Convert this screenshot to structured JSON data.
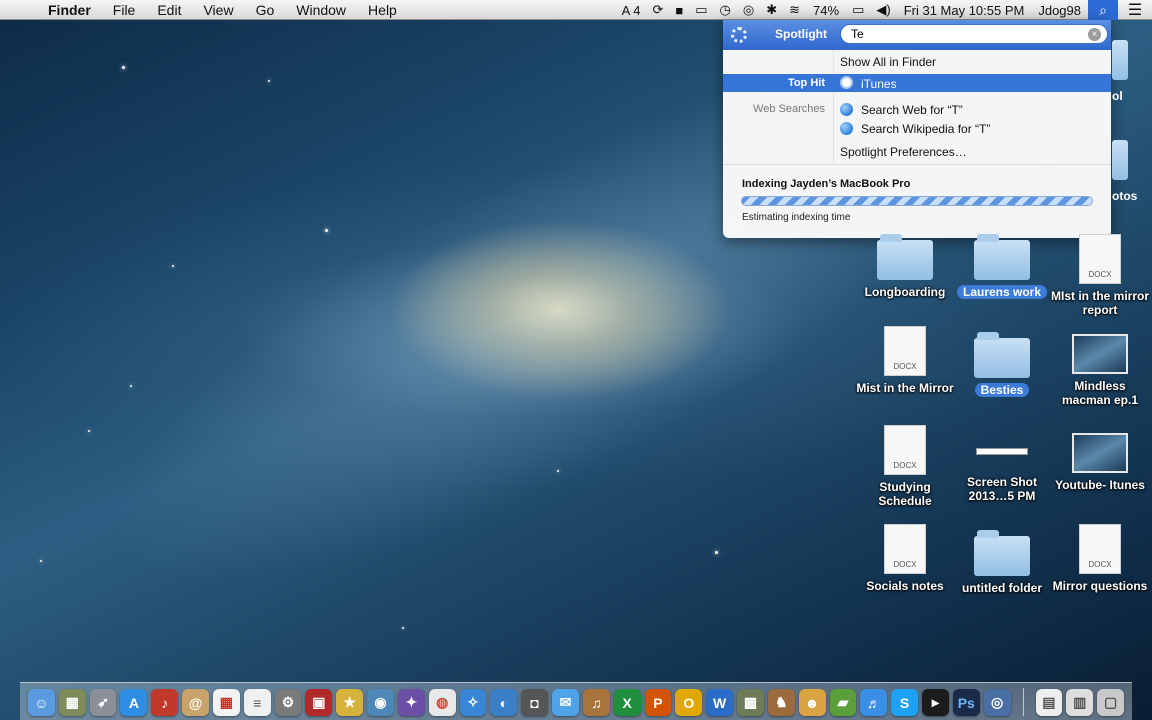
{
  "menubar": {
    "app_name": "Finder",
    "menus": [
      "File",
      "Edit",
      "View",
      "Go",
      "Window",
      "Help"
    ],
    "status": {
      "adobe_count": "4",
      "battery": "74%",
      "datetime": "Fri 31 May  10:55 PM",
      "user": "Jdog98"
    }
  },
  "spotlight": {
    "title": "Spotlight",
    "query": "Te",
    "show_all": "Show All in Finder",
    "top_hit_label": "Top Hit",
    "top_hit": "iTunes",
    "web_searches_label": "Web Searches",
    "web_search_1": "Search Web for “T”",
    "web_search_2": "Search Wikipedia for “T”",
    "preferences": "Spotlight Preferences…",
    "indexing_title": "Indexing Jayden’s MacBook Pro",
    "indexing_status": "Estimating indexing time"
  },
  "desktop": {
    "partial_labels": [
      "ol",
      "otos"
    ],
    "icons": [
      {
        "label": "Longboarding",
        "type": "folder"
      },
      {
        "label": "Laurens work",
        "type": "folder"
      },
      {
        "label": "MIst in the mirror report",
        "type": "docx"
      },
      {
        "label": "Mist in the Mirror",
        "type": "docx"
      },
      {
        "label": "Besties",
        "type": "folder"
      },
      {
        "label": "Mindless macman ep.1",
        "type": "movie"
      },
      {
        "label": "Studying Schedule",
        "type": "docx"
      },
      {
        "label": "Screen Shot 2013…5 PM",
        "type": "screenshot"
      },
      {
        "label": "Youtube- Itunes",
        "type": "movie"
      },
      {
        "label": "Socials notes",
        "type": "docx"
      },
      {
        "label": "untitled folder",
        "type": "folder"
      },
      {
        "label": "Mirror questions",
        "type": "docx"
      }
    ],
    "docx_ext": "DOCX"
  },
  "dock": {
    "apps": [
      "finder-icon",
      "dashboard-icon",
      "launchpad-icon",
      "app-store-icon",
      "music-red-icon",
      "contacts-icon",
      "calendar-icon",
      "reminders-icon",
      "misc-icon",
      "photo-booth-icon",
      "imovie-icon",
      "iphoto-icon",
      "wizard-icon",
      "chrome-icon",
      "safari-icon",
      "ical-icon",
      "facetime-icon",
      "messages-icon",
      "garageband-icon",
      "excel-icon",
      "powerpoint-icon",
      "outlook-icon",
      "word-icon",
      "game-icon",
      "deer-icon",
      "games-icon",
      "minecraft-icon",
      "itunes-icon",
      "skype-icon",
      "terminal-icon",
      "photoshop-icon",
      "downloads-icon",
      "docs-icon",
      "documents-icon",
      "trash-icon"
    ]
  }
}
